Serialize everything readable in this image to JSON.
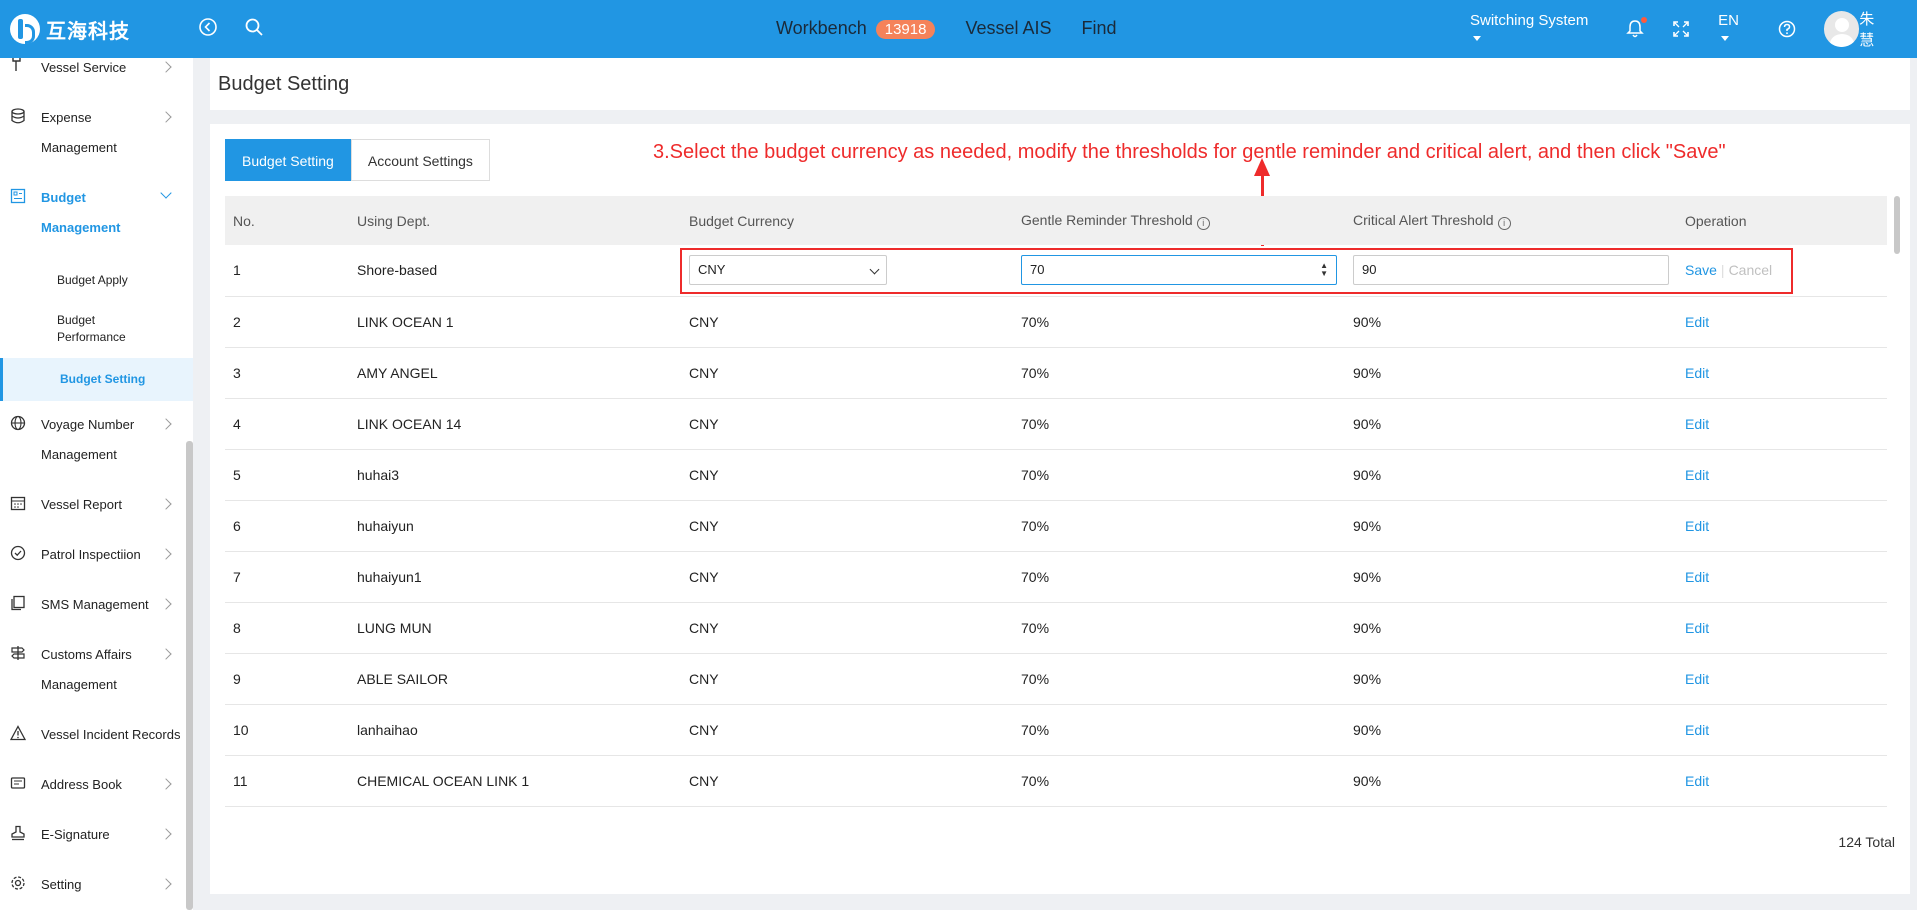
{
  "app": {
    "logo_text": "互海科技"
  },
  "topbar": {
    "nav": [
      {
        "label": "Workbench",
        "badge": "13918"
      },
      {
        "label": "Vessel AIS"
      },
      {
        "label": "Find"
      }
    ],
    "switching": "Switching System",
    "language": "EN",
    "user_name": "朱慧"
  },
  "sidebar": {
    "items": [
      {
        "line1": "Vessel Service",
        "line2": ""
      },
      {
        "line1": "Expense",
        "line2": "Management"
      },
      {
        "line1": "Budget",
        "line2": "Management"
      },
      {
        "line1": "Voyage Number",
        "line2": "Management"
      },
      {
        "line1": "Vessel Report",
        "line2": ""
      },
      {
        "line1": "Patrol Inspectiion",
        "line2": ""
      },
      {
        "line1": "SMS Management",
        "line2": ""
      },
      {
        "line1": "Customs Affairs",
        "line2": "Management"
      },
      {
        "line1": "Vessel Incident Records",
        "line2": ""
      },
      {
        "line1": "Address Book",
        "line2": ""
      },
      {
        "line1": "E-Signature",
        "line2": ""
      },
      {
        "line1": "Setting",
        "line2": ""
      }
    ],
    "sub_items": [
      {
        "line1": "Budget Apply",
        "line2": ""
      },
      {
        "line1": "Budget",
        "line2": "Performance"
      },
      {
        "line1": "Budget Setting",
        "line2": ""
      }
    ]
  },
  "page": {
    "title": "Budget Setting",
    "tabs": [
      "Budget Setting",
      "Account Settings"
    ],
    "annotation": "3.Select the budget currency as needed, modify the thresholds for gentle reminder and critical alert, and then click \"Save\"",
    "total": "124 Total"
  },
  "table": {
    "headers": [
      "No.",
      "Using Dept.",
      "Budget Currency",
      "Gentle Reminder Threshold",
      "Critical Alert Threshold",
      "Operation"
    ],
    "edit_row": {
      "no": "1",
      "dept": "Shore-based",
      "currency": "CNY",
      "gentle": "70",
      "critical": "90",
      "save": "Save",
      "cancel": "Cancel"
    },
    "rows": [
      {
        "no": "2",
        "dept": "LINK OCEAN 1",
        "currency": "CNY",
        "gentle": "70%",
        "critical": "90%",
        "op": "Edit"
      },
      {
        "no": "3",
        "dept": "AMY ANGEL",
        "currency": "CNY",
        "gentle": "70%",
        "critical": "90%",
        "op": "Edit"
      },
      {
        "no": "4",
        "dept": "LINK OCEAN 14",
        "currency": "CNY",
        "gentle": "70%",
        "critical": "90%",
        "op": "Edit"
      },
      {
        "no": "5",
        "dept": "huhai3",
        "currency": "CNY",
        "gentle": "70%",
        "critical": "90%",
        "op": "Edit"
      },
      {
        "no": "6",
        "dept": "huhaiyun",
        "currency": "CNY",
        "gentle": "70%",
        "critical": "90%",
        "op": "Edit"
      },
      {
        "no": "7",
        "dept": "huhaiyun1",
        "currency": "CNY",
        "gentle": "70%",
        "critical": "90%",
        "op": "Edit"
      },
      {
        "no": "8",
        "dept": "LUNG MUN",
        "currency": "CNY",
        "gentle": "70%",
        "critical": "90%",
        "op": "Edit"
      },
      {
        "no": "9",
        "dept": "ABLE SAILOR",
        "currency": "CNY",
        "gentle": "70%",
        "critical": "90%",
        "op": "Edit"
      },
      {
        "no": "10",
        "dept": "lanhaihao",
        "currency": "CNY",
        "gentle": "70%",
        "critical": "90%",
        "op": "Edit"
      },
      {
        "no": "11",
        "dept": "CHEMICAL OCEAN LINK 1",
        "currency": "CNY",
        "gentle": "70%",
        "critical": "90%",
        "op": "Edit"
      }
    ]
  },
  "colors": {
    "primary": "#2196e3",
    "annotation": "#ee2b2b",
    "badge": "#f5825a"
  }
}
